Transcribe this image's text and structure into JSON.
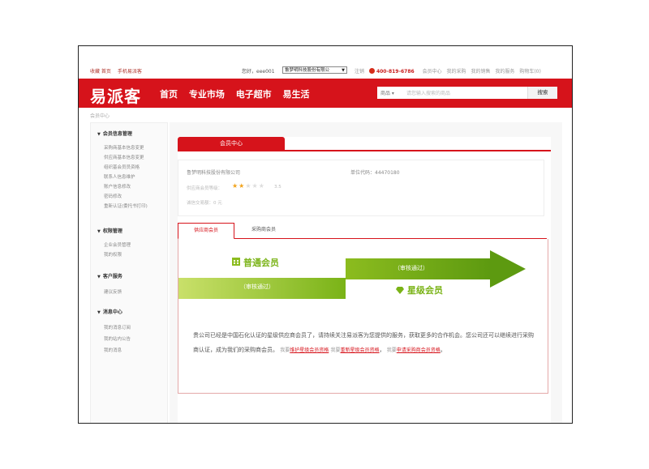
{
  "topbar": {
    "left_links": [
      "收藏 首页",
      "手机易派客"
    ],
    "greeting": "您好，eee001",
    "company_select": "鲁梦明科技股份有限公",
    "register": "注销",
    "phone": "400-819-6786",
    "links": [
      "会员中心",
      "我的采购",
      "我的销售",
      "我的服务",
      "购物车(0)"
    ]
  },
  "nav": {
    "logo": "易派客",
    "menu": [
      "首页",
      "专业市场",
      "电子超市",
      "易生活"
    ],
    "search_category": "商品",
    "search_placeholder": "请您输入搜索的商品",
    "search_button": "搜索"
  },
  "breadcrumb": "会员中心",
  "sidebar": {
    "sections": [
      {
        "title": "会员信息管理",
        "items": [
          "采购商基本信息变更",
          "供应商基本信息变更",
          "组织基会员员资格",
          "联系人信息维护",
          "账户信息修改",
          "密码修改",
          "重新认证(委托书打印)"
        ]
      },
      {
        "title": "权限管理",
        "items": [
          "企业会员管理",
          "我的权限"
        ]
      },
      {
        "title": "客户服务",
        "items": [
          "建议反馈"
        ]
      },
      {
        "title": "消息中心",
        "items": [
          "我的消息订阅",
          "我的站内公告",
          "我的消息"
        ]
      }
    ]
  },
  "main": {
    "tab_title": "会员中心",
    "company_name": "鲁梦明科技股份有限公司",
    "unit_code": "单位代码：44470180",
    "rating_label": "供应商会员等级：",
    "rating_score": "3.5",
    "rating_value": 2,
    "deal_count": "诚信交易额：0 元",
    "sub_tabs": [
      "供应商会员",
      "采购商会员"
    ],
    "graphic": {
      "ordinary_member": "普通会员",
      "audit_pass_1": "（审核通过）",
      "audit_pass_2": "（审核通过）",
      "star_member": "星级会员"
    },
    "desc_main": "贵公司已经是中国石化认证的星级供应商会员了，请持续关注易派客为您提供的服务，获取更多的合作机会。您公司还可以继续进行采购商认证，成为我们的采购商会员。",
    "desc_link1_prefix": "我要",
    "desc_link1": "维护星级会员资格",
    "desc_link2_prefix": "我要",
    "desc_link2": "重新星级会员资格",
    "desc_link3_prefix": "我要",
    "desc_link3": "申请采购商会员资格"
  },
  "colors": {
    "brand_red": "#d6131b",
    "green_dark": "#7ab317",
    "green_light": "#c9e06a",
    "star_gold": "#f2a31b"
  }
}
